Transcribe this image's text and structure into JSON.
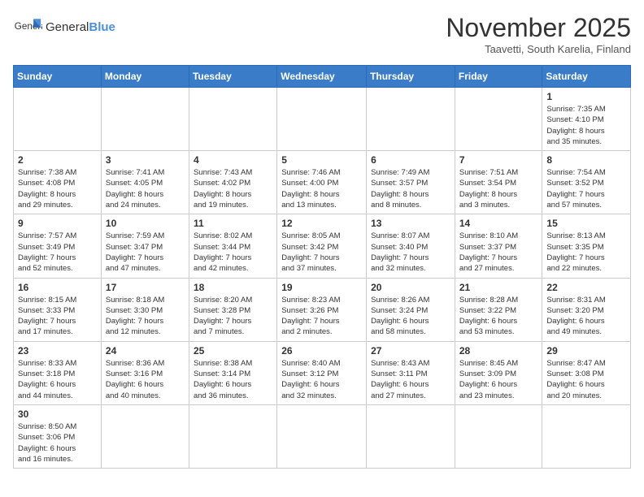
{
  "header": {
    "logo_general": "General",
    "logo_blue": "Blue",
    "month_title": "November 2025",
    "subtitle": "Taavetti, South Karelia, Finland"
  },
  "weekdays": [
    "Sunday",
    "Monday",
    "Tuesday",
    "Wednesday",
    "Thursday",
    "Friday",
    "Saturday"
  ],
  "weeks": [
    [
      {
        "day": "",
        "info": ""
      },
      {
        "day": "",
        "info": ""
      },
      {
        "day": "",
        "info": ""
      },
      {
        "day": "",
        "info": ""
      },
      {
        "day": "",
        "info": ""
      },
      {
        "day": "",
        "info": ""
      },
      {
        "day": "1",
        "info": "Sunrise: 7:35 AM\nSunset: 4:10 PM\nDaylight: 8 hours\nand 35 minutes."
      }
    ],
    [
      {
        "day": "2",
        "info": "Sunrise: 7:38 AM\nSunset: 4:08 PM\nDaylight: 8 hours\nand 29 minutes."
      },
      {
        "day": "3",
        "info": "Sunrise: 7:41 AM\nSunset: 4:05 PM\nDaylight: 8 hours\nand 24 minutes."
      },
      {
        "day": "4",
        "info": "Sunrise: 7:43 AM\nSunset: 4:02 PM\nDaylight: 8 hours\nand 19 minutes."
      },
      {
        "day": "5",
        "info": "Sunrise: 7:46 AM\nSunset: 4:00 PM\nDaylight: 8 hours\nand 13 minutes."
      },
      {
        "day": "6",
        "info": "Sunrise: 7:49 AM\nSunset: 3:57 PM\nDaylight: 8 hours\nand 8 minutes."
      },
      {
        "day": "7",
        "info": "Sunrise: 7:51 AM\nSunset: 3:54 PM\nDaylight: 8 hours\nand 3 minutes."
      },
      {
        "day": "8",
        "info": "Sunrise: 7:54 AM\nSunset: 3:52 PM\nDaylight: 7 hours\nand 57 minutes."
      }
    ],
    [
      {
        "day": "9",
        "info": "Sunrise: 7:57 AM\nSunset: 3:49 PM\nDaylight: 7 hours\nand 52 minutes."
      },
      {
        "day": "10",
        "info": "Sunrise: 7:59 AM\nSunset: 3:47 PM\nDaylight: 7 hours\nand 47 minutes."
      },
      {
        "day": "11",
        "info": "Sunrise: 8:02 AM\nSunset: 3:44 PM\nDaylight: 7 hours\nand 42 minutes."
      },
      {
        "day": "12",
        "info": "Sunrise: 8:05 AM\nSunset: 3:42 PM\nDaylight: 7 hours\nand 37 minutes."
      },
      {
        "day": "13",
        "info": "Sunrise: 8:07 AM\nSunset: 3:40 PM\nDaylight: 7 hours\nand 32 minutes."
      },
      {
        "day": "14",
        "info": "Sunrise: 8:10 AM\nSunset: 3:37 PM\nDaylight: 7 hours\nand 27 minutes."
      },
      {
        "day": "15",
        "info": "Sunrise: 8:13 AM\nSunset: 3:35 PM\nDaylight: 7 hours\nand 22 minutes."
      }
    ],
    [
      {
        "day": "16",
        "info": "Sunrise: 8:15 AM\nSunset: 3:33 PM\nDaylight: 7 hours\nand 17 minutes."
      },
      {
        "day": "17",
        "info": "Sunrise: 8:18 AM\nSunset: 3:30 PM\nDaylight: 7 hours\nand 12 minutes."
      },
      {
        "day": "18",
        "info": "Sunrise: 8:20 AM\nSunset: 3:28 PM\nDaylight: 7 hours\nand 7 minutes."
      },
      {
        "day": "19",
        "info": "Sunrise: 8:23 AM\nSunset: 3:26 PM\nDaylight: 7 hours\nand 2 minutes."
      },
      {
        "day": "20",
        "info": "Sunrise: 8:26 AM\nSunset: 3:24 PM\nDaylight: 6 hours\nand 58 minutes."
      },
      {
        "day": "21",
        "info": "Sunrise: 8:28 AM\nSunset: 3:22 PM\nDaylight: 6 hours\nand 53 minutes."
      },
      {
        "day": "22",
        "info": "Sunrise: 8:31 AM\nSunset: 3:20 PM\nDaylight: 6 hours\nand 49 minutes."
      }
    ],
    [
      {
        "day": "23",
        "info": "Sunrise: 8:33 AM\nSunset: 3:18 PM\nDaylight: 6 hours\nand 44 minutes."
      },
      {
        "day": "24",
        "info": "Sunrise: 8:36 AM\nSunset: 3:16 PM\nDaylight: 6 hours\nand 40 minutes."
      },
      {
        "day": "25",
        "info": "Sunrise: 8:38 AM\nSunset: 3:14 PM\nDaylight: 6 hours\nand 36 minutes."
      },
      {
        "day": "26",
        "info": "Sunrise: 8:40 AM\nSunset: 3:12 PM\nDaylight: 6 hours\nand 32 minutes."
      },
      {
        "day": "27",
        "info": "Sunrise: 8:43 AM\nSunset: 3:11 PM\nDaylight: 6 hours\nand 27 minutes."
      },
      {
        "day": "28",
        "info": "Sunrise: 8:45 AM\nSunset: 3:09 PM\nDaylight: 6 hours\nand 23 minutes."
      },
      {
        "day": "29",
        "info": "Sunrise: 8:47 AM\nSunset: 3:08 PM\nDaylight: 6 hours\nand 20 minutes."
      }
    ],
    [
      {
        "day": "30",
        "info": "Sunrise: 8:50 AM\nSunset: 3:06 PM\nDaylight: 6 hours\nand 16 minutes."
      },
      {
        "day": "",
        "info": ""
      },
      {
        "day": "",
        "info": ""
      },
      {
        "day": "",
        "info": ""
      },
      {
        "day": "",
        "info": ""
      },
      {
        "day": "",
        "info": ""
      },
      {
        "day": "",
        "info": ""
      }
    ]
  ]
}
